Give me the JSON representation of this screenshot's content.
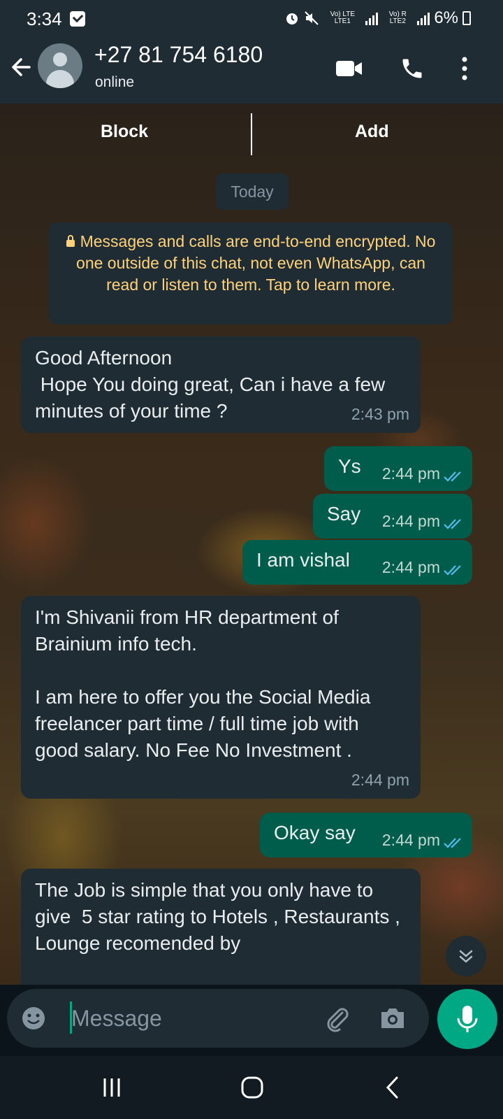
{
  "status_bar": {
    "time": "3:34",
    "sim1": "Vo) LTE LTE1",
    "sim2": "Vo) R LTE2",
    "battery": "6%"
  },
  "header": {
    "contact": "+27 81 754 6180",
    "status": "online"
  },
  "action_bar": {
    "block": "Block",
    "add": "Add"
  },
  "date_chip": "Today",
  "encryption_notice": "Messages and calls are end-to-end encrypted. No one outside of this chat, not even WhatsApp, can read or listen to them. Tap to learn more.",
  "messages": [
    {
      "dir": "in",
      "text": "Good Afternoon\n Hope You doing great, Can i have a few minutes of your time ?",
      "time": "2:43 pm"
    },
    {
      "dir": "out",
      "text": "Ys",
      "time": "2:44 pm"
    },
    {
      "dir": "out",
      "text": "Say",
      "time": "2:44 pm"
    },
    {
      "dir": "out",
      "text": "I am vishal",
      "time": "2:44 pm"
    },
    {
      "dir": "in",
      "text": "I'm Shivanii from HR department of Brainium info tech.\n\nI am here to offer you the Social Media freelancer part time / full time job with good salary. No Fee No Investment .",
      "time": "2:44 pm"
    },
    {
      "dir": "out",
      "text": "Okay say",
      "time": "2:44 pm"
    },
    {
      "dir": "in",
      "text": "The Job is simple that you only have to give  5 star rating to Hotels , Restaurants , Lounge recomended by",
      "time": ""
    }
  ],
  "input": {
    "placeholder": "Message"
  },
  "colors": {
    "header": "#1f2c34",
    "incoming": "#1f2c34",
    "outgoing": "#005c4b",
    "accent": "#00a884",
    "read_ticks": "#53bdeb"
  }
}
